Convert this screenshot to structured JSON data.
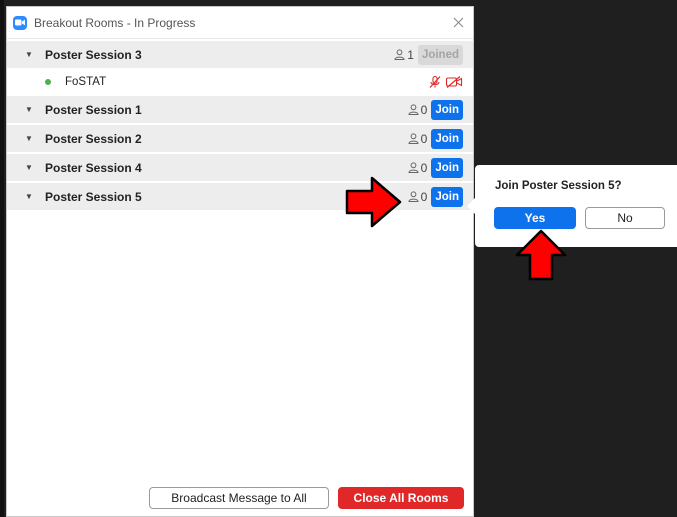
{
  "window": {
    "title": "Breakout Rooms - In Progress",
    "app_icon": "zoom-camera-icon",
    "close_icon": "close-icon"
  },
  "rooms": [
    {
      "name": "Poster Session 3",
      "count": "1",
      "action": "Joined",
      "state": "joined"
    },
    {
      "name": "Poster Session 1",
      "count": "0",
      "action": "Join",
      "state": "join"
    },
    {
      "name": "Poster Session 2",
      "count": "0",
      "action": "Join",
      "state": "join"
    },
    {
      "name": "Poster Session 4",
      "count": "0",
      "action": "Join",
      "state": "join"
    },
    {
      "name": "Poster Session 5",
      "count": "0",
      "action": "Join",
      "state": "join"
    }
  ],
  "participant": {
    "name": "FoSTAT",
    "icons": [
      "mic-muted-icon",
      "video-off-icon"
    ]
  },
  "footer": {
    "broadcast_label": "Broadcast Message to All",
    "close_all_label": "Close All Rooms"
  },
  "popup": {
    "question": "Join Poster Session 5?",
    "yes_label": "Yes",
    "no_label": "No"
  },
  "colors": {
    "accent_blue": "#0e72ed",
    "danger_red": "#e02828",
    "annotation_arrow": "#ff0000",
    "online_dot": "#4caf50"
  }
}
